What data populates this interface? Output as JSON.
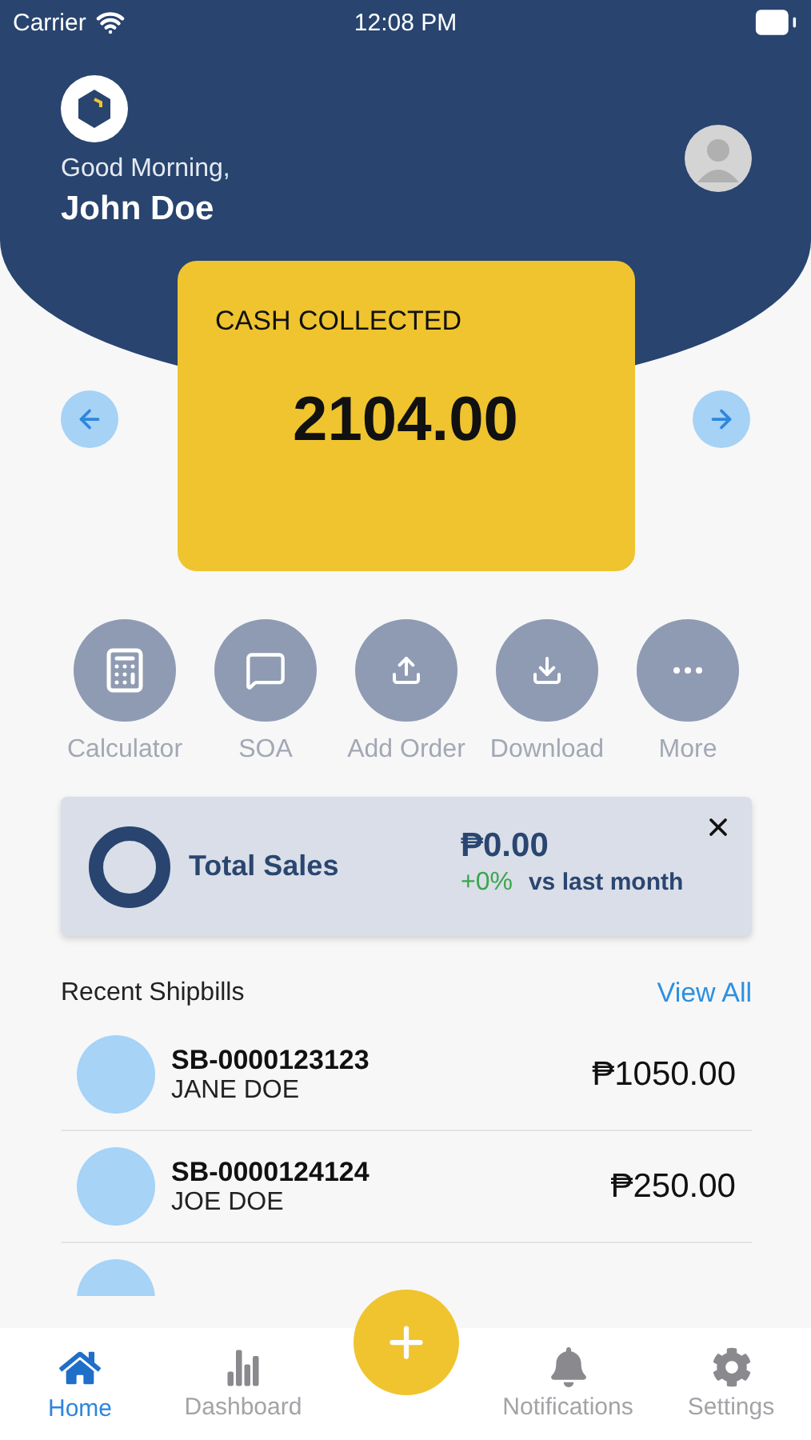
{
  "status_bar": {
    "carrier": "Carrier",
    "time": "12:08 PM"
  },
  "header": {
    "greeting": "Good Morning,",
    "name": "John Doe"
  },
  "balance_card": {
    "label": "CASH COLLECTED",
    "amount": "2104.00"
  },
  "actions": [
    {
      "kind": "calculator",
      "label": "Calculator"
    },
    {
      "kind": "message",
      "label": "SOA"
    },
    {
      "kind": "upload",
      "label": "Add Order"
    },
    {
      "kind": "download",
      "label": "Download"
    },
    {
      "kind": "more",
      "label": "More"
    }
  ],
  "sales_card": {
    "title": "Total Sales",
    "amount": "₱0.00",
    "change": "+0%",
    "comparison": "vs last month"
  },
  "recent": {
    "title": "Recent Shipbills",
    "link": "View All",
    "rows": [
      {
        "id": "SB-0000123123",
        "name": "JANE DOE",
        "amount": "₱1050.00"
      },
      {
        "id": "SB-0000124124",
        "name": "JOE DOE",
        "amount": "₱250.00"
      },
      {}
    ]
  },
  "tab_bar": [
    {
      "kind": "home",
      "label": "Home",
      "selected": true
    },
    {
      "kind": "dashboard",
      "label": "Dashboard",
      "selected": false
    },
    {
      "kind": "notifications",
      "label": "Notifications",
      "selected": false
    },
    {
      "kind": "settings",
      "label": "Settings",
      "selected": false
    }
  ]
}
